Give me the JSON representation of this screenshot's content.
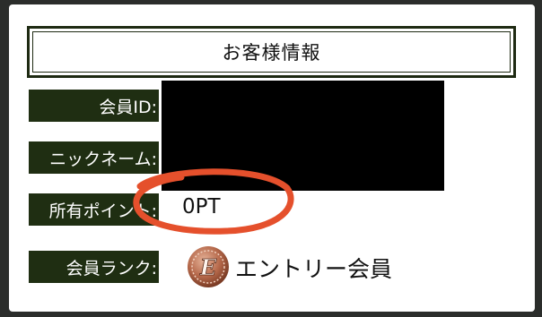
{
  "header": {
    "title": "お客様情報"
  },
  "fields": {
    "member_id_label": "会員ID:",
    "nickname_label": "ニックネーム:",
    "points_label": "所有ポイント:",
    "points_value": "0PT",
    "rank_label": "会員ランク:",
    "rank_value": "エントリー会員",
    "rank_badge_letter": "E"
  },
  "colors": {
    "label_bg": "#1f2e12",
    "annotation_circle": "#e5502c",
    "medal": "#b5684a"
  },
  "icons": {
    "rank_badge": "entry-medal-icon"
  }
}
